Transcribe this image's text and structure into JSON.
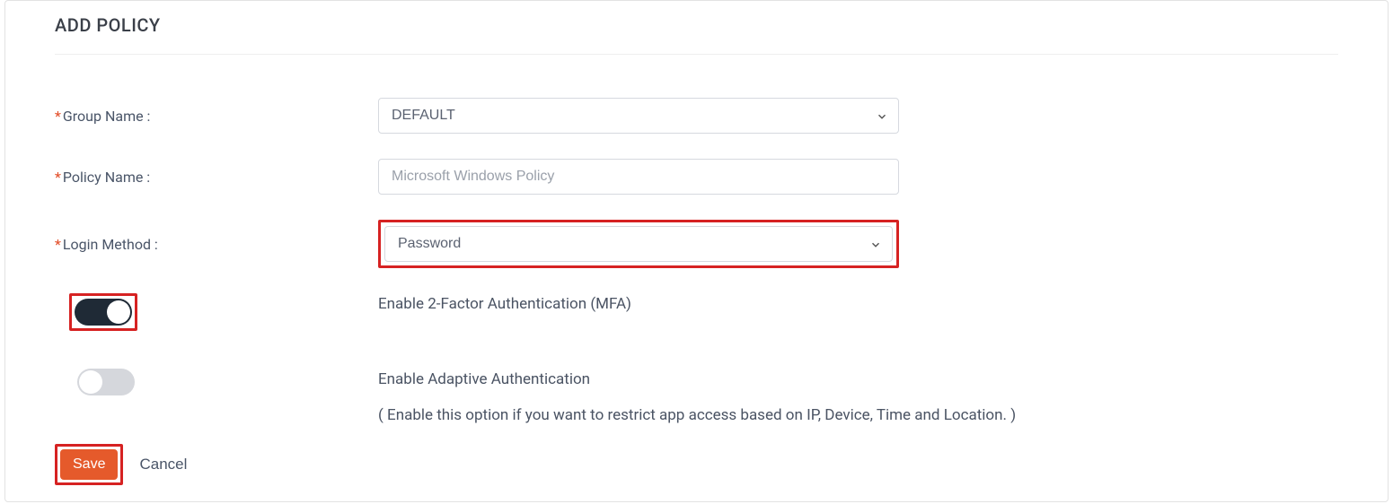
{
  "page": {
    "title": "ADD POLICY"
  },
  "form": {
    "group_name": {
      "label": "Group Name :",
      "required": "*",
      "value": "DEFAULT"
    },
    "policy_name": {
      "label": "Policy Name :",
      "required": "*",
      "placeholder": "Microsoft Windows Policy",
      "value": ""
    },
    "login_method": {
      "label": "Login Method :",
      "required": "*",
      "value": "Password"
    },
    "mfa": {
      "label": "Enable 2-Factor Authentication (MFA)",
      "enabled": true
    },
    "adaptive": {
      "label": "Enable Adaptive Authentication",
      "hint": "( Enable this option if you want to restrict app access based on IP, Device, Time and Location. )",
      "enabled": false
    }
  },
  "actions": {
    "save": "Save",
    "cancel": "Cancel"
  }
}
